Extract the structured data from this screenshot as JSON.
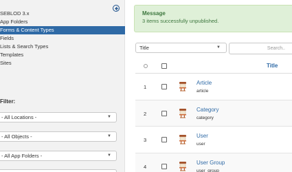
{
  "sidebar": {
    "items": [
      {
        "label": "SEBLOD 3.x",
        "active": false
      },
      {
        "label": "App Folders",
        "active": false
      },
      {
        "label": "Forms & Content Types",
        "active": true
      },
      {
        "label": "Fields",
        "active": false
      },
      {
        "label": "Lists & Search Types",
        "active": false
      },
      {
        "label": "Templates",
        "active": false
      },
      {
        "label": "Sites",
        "active": false
      }
    ],
    "filter_title": "Filter:",
    "filters": [
      {
        "value": "- All Locations -"
      },
      {
        "value": "- All Objects -"
      },
      {
        "value": "- All App Folders -"
      }
    ]
  },
  "message": {
    "title": "Message",
    "text": "3 items successfully unpublished."
  },
  "toolbar": {
    "sort_value": "Title",
    "search_placeholder": "Search.."
  },
  "table": {
    "header_title": "Title",
    "rows": [
      {
        "num": "1",
        "name": "Article",
        "sub": "article"
      },
      {
        "num": "2",
        "name": "Category",
        "sub": "category"
      },
      {
        "num": "3",
        "name": "User",
        "sub": "user"
      },
      {
        "num": "4",
        "name": "User Group",
        "sub": "user_group"
      }
    ]
  },
  "colors": {
    "accent": "#2f6aa6",
    "success_bg": "#dff0d8",
    "success_text": "#3c763d"
  }
}
